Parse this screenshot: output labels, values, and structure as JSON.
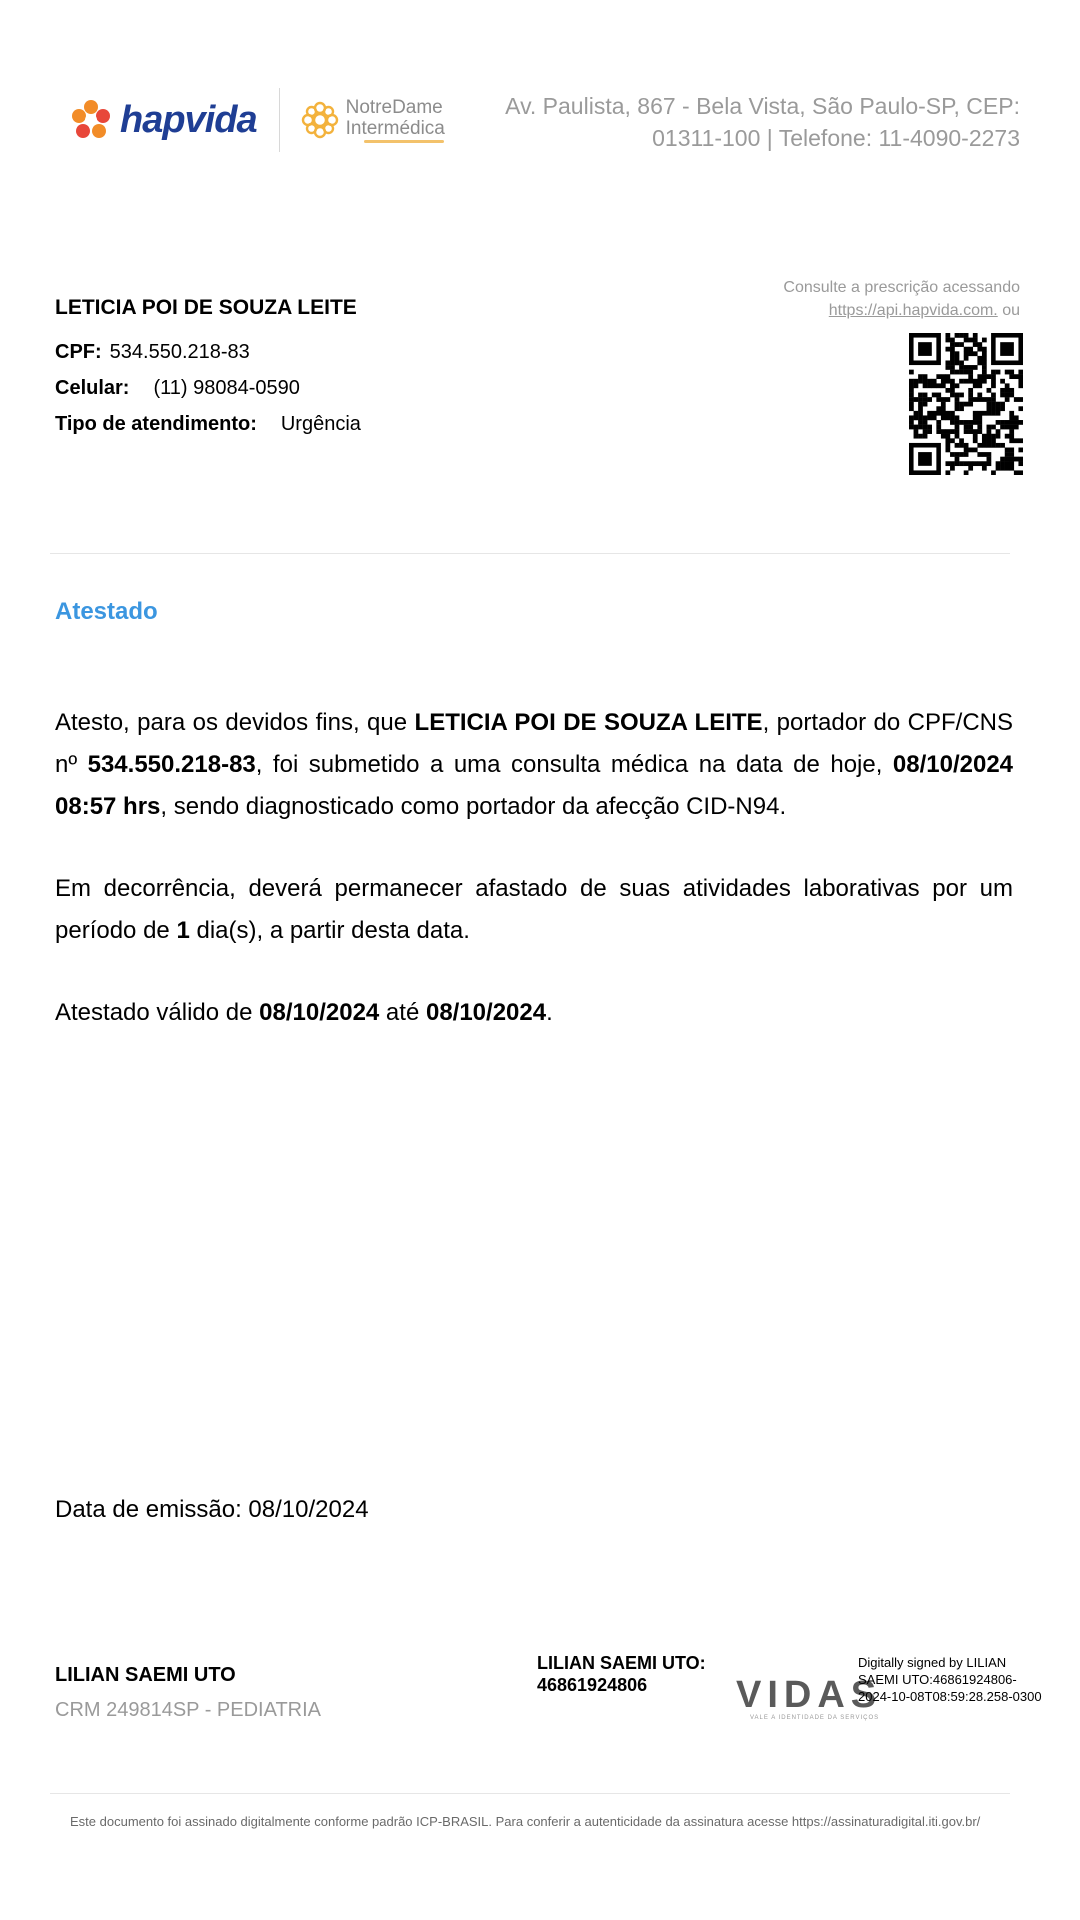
{
  "header": {
    "logo_primary": "hapvida",
    "logo_secondary_line1": "NotreDame",
    "logo_secondary_line2": "Intermédica",
    "address_line1": "Av. Paulista, 867 - Bela Vista, São Paulo-SP,  CEP:",
    "address_line2": "01311-100 | Telefone: 11-4090-2273",
    "brand_colors": {
      "hapvida_blue": "#1f3e94",
      "hapvida_orange": "#f28c28",
      "hapvida_red": "#e8473a",
      "notredame_gold": "#f3b23c"
    }
  },
  "patient": {
    "name": "LETICIA POI DE SOUZA LEITE",
    "cpf_label": "CPF:",
    "cpf": "534.550.218-83",
    "phone_label": "Celular:",
    "phone": "(11) 98084-0590",
    "service_label": "Tipo de atendimento:",
    "service": "Urgência"
  },
  "verification": {
    "line1": "Consulte a prescrição acessando",
    "link": "https://api.hapvida.com.",
    "suffix": " ou",
    "qr_icon": "qr-code-icon"
  },
  "document": {
    "title": "Atestado",
    "title_color": "#3b96e0",
    "p1_a": "Atesto, para os devidos fins, que ",
    "p1_name": "LETICIA POI DE SOUZA LEITE",
    "p1_b": ", portador do CPF/CNS nº ",
    "p1_cpf": "534.550.218-83",
    "p1_c": ", foi submetido a uma consulta médica na data de hoje, ",
    "p1_datetime": "08/10/2024 08:57 hrs",
    "p1_d": ", sendo diagnosticado como portador da afecção CID-N94.",
    "p2_a": "Em decorrência, deverá permanecer afastado de suas atividades laborativas por um período de ",
    "p2_days": "1",
    "p2_b": " dia(s), a partir desta data.",
    "p3_a": "Atestado válido de ",
    "p3_from": "08/10/2024",
    "p3_b": " até ",
    "p3_to": "08/10/2024",
    "p3_c": "."
  },
  "emission": "Data de emissão: 08/10/2024",
  "doctor": {
    "name": "LILIAN SAEMI UTO",
    "crm": "CRM  249814SP -  PEDIATRIA"
  },
  "signature": {
    "signer_line1": "LILIAN SAEMI UTO:",
    "signer_line2": "46861924806",
    "stamp_logo": "VIDAS",
    "stamp_tagline": "VALE A IDENTIDADE DA SERVIÇOS",
    "digital_line1": "Digitally signed by LILIAN",
    "digital_line2": "SAEMI UTO:46861924806-",
    "digital_line3": "2024-10-08T08:59:28.258-0300"
  },
  "footer": {
    "note": "Este documento foi assinado digitalmente conforme padrão ICP-BRASIL. Para conferir a autenticidade da assinatura acesse https://assinaturadigital.iti.gov.br/"
  }
}
